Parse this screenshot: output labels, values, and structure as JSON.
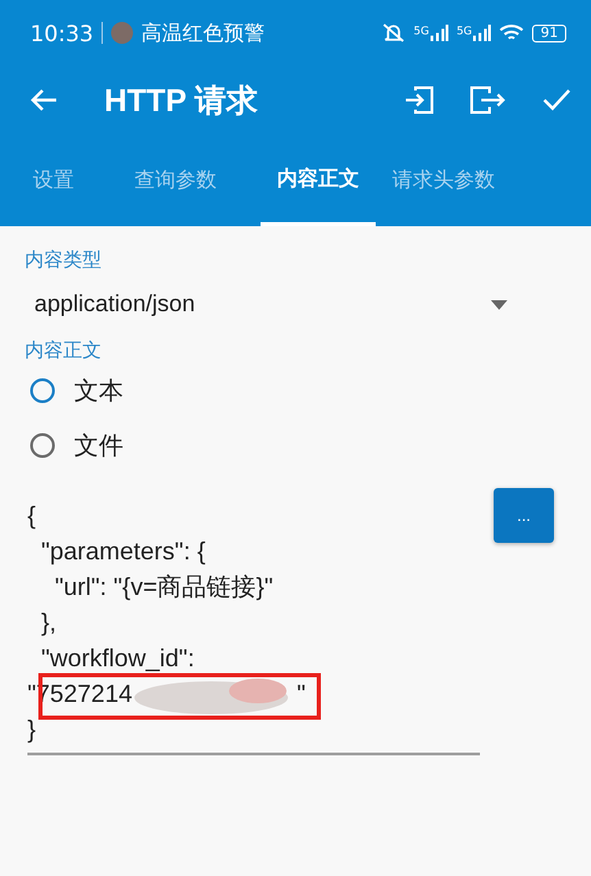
{
  "status_bar": {
    "time": "10:33",
    "notification": "高温红色预警",
    "network_1": "5G",
    "network_2": "5G",
    "battery": "91"
  },
  "app_bar": {
    "title": "HTTP 请求"
  },
  "tabs": [
    {
      "label": "设置",
      "selected": false
    },
    {
      "label": "查询参数",
      "selected": false
    },
    {
      "label": "内容正文",
      "selected": true
    },
    {
      "label": "请求头参数",
      "selected": false
    }
  ],
  "content_type": {
    "label": "内容类型",
    "value": "application/json"
  },
  "body": {
    "label": "内容正文",
    "options": [
      {
        "label": "文本",
        "selected": true
      },
      {
        "label": "文件",
        "selected": false
      }
    ],
    "lines": [
      "{",
      "  \"parameters\": {",
      "    \"url\": \"{v=商品链接}\"",
      "  },",
      "  \"workflow_id\":"
    ],
    "redacted_line": {
      "start": "\"7527214",
      "end": "\""
    },
    "last_line": "}",
    "more_button": "..."
  }
}
